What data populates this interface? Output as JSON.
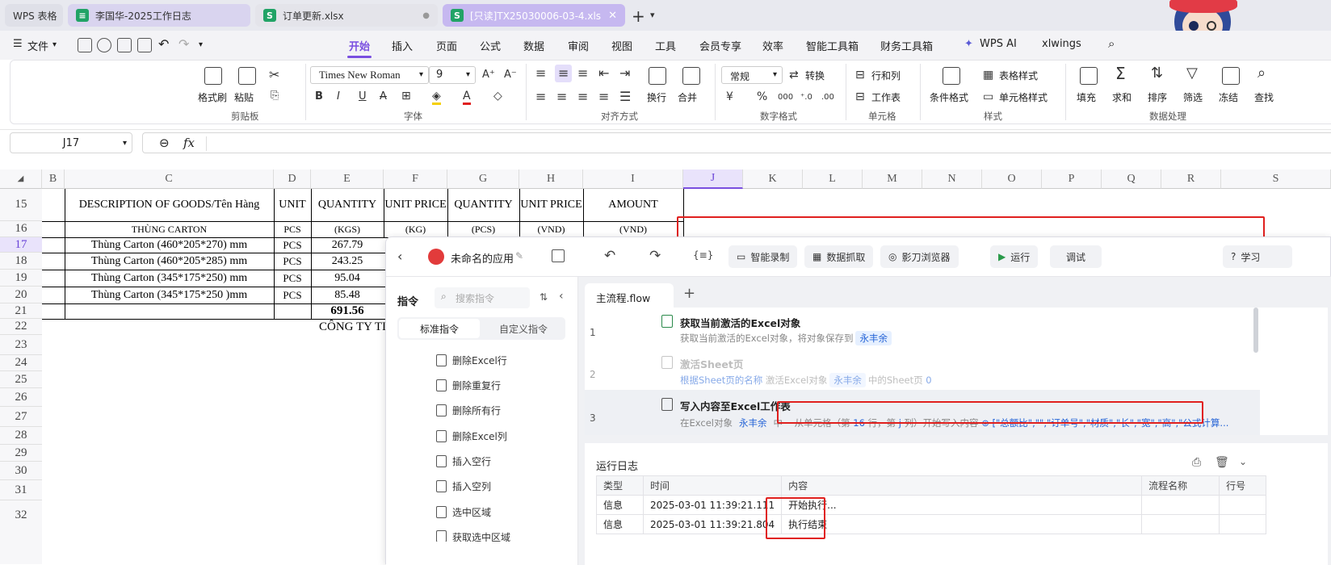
{
  "tabs": [
    {
      "label": "WPS 表格"
    },
    {
      "label": "李国华-2025工作日志",
      "icon": "≡"
    },
    {
      "label": "订单更新.xlsx",
      "icon": "S"
    },
    {
      "label": "[只读]TX25030006-03-4.xls",
      "icon": "S"
    }
  ],
  "menu": {
    "file": "文件",
    "items": [
      "开始",
      "插入",
      "页面",
      "公式",
      "数据",
      "审阅",
      "视图",
      "工具",
      "会员专享",
      "效率",
      "智能工具箱",
      "财务工具箱",
      "WPS AI",
      "xlwings"
    ],
    "active": "开始"
  },
  "ribbon": {
    "format_painter": "格式刷",
    "paste": "粘贴",
    "clipboard": "剪贴板",
    "font_name": "Times New Roman",
    "font_size": "9",
    "font_group": "字体",
    "wrap": "换行",
    "merge": "合并",
    "align_group": "对齐方式",
    "number_format": "常规",
    "convert": "转换",
    "number_group": "数字格式",
    "rows_cols": "行和列",
    "worksheet": "工作表",
    "cell_group": "单元格",
    "cond_format": "条件格式",
    "table_style": "表格样式",
    "cell_style": "单元格样式",
    "style_group": "样式",
    "fill": "填充",
    "sum": "求和",
    "sort": "排序",
    "filter": "筛选",
    "freeze": "冻结",
    "find": "查找",
    "data_group": "数据处理"
  },
  "formula_bar": {
    "name_box": "J17",
    "fx": "fx",
    "value": ""
  },
  "grid": {
    "columns": [
      "B",
      "C",
      "D",
      "E",
      "F",
      "G",
      "H",
      "I",
      "J",
      "K",
      "L",
      "M",
      "N",
      "O",
      "P",
      "Q",
      "R",
      "S"
    ],
    "rows": [
      "15",
      "16",
      "17",
      "18",
      "19",
      "20",
      "21",
      "22",
      "23",
      "24",
      "25",
      "26",
      "27",
      "28",
      "29",
      "30",
      "31",
      "32"
    ],
    "header15": [
      "DESCRIPTION OF GOODS/Tên Hàng",
      "UNIT",
      "QUANTITY",
      "UNIT PRICE",
      "QUANTITY",
      "UNIT PRICE",
      "AMOUNT"
    ],
    "header16": [
      "THÙNG CARTON",
      "PCS",
      "(KGS)",
      "(KG)",
      "(PCS)",
      "(VND)",
      "(VND)"
    ],
    "items": [
      {
        "desc": "Thùng Carton (460*205*270) mm",
        "unit": "PCS",
        "qty": "267.79"
      },
      {
        "desc": "Thùng Carton (460*205*285) mm",
        "unit": "PCS",
        "qty": "243.25"
      },
      {
        "desc": "Thùng Carton (345*175*250) mm",
        "unit": "PCS",
        "qty": "95.04"
      },
      {
        "desc": "Thùng Carton (345*175*250 )mm",
        "unit": "PCS",
        "qty": "85.48"
      }
    ],
    "total": "691.56",
    "company": "CÔNG TY TI"
  },
  "rpa": {
    "app_name": "未命名的应用",
    "toolbar": {
      "smart_record": "智能录制",
      "data_grab": "数据抓取",
      "browser": "影刀浏览器",
      "run": "运行",
      "debug": "调试",
      "learn": "学习"
    },
    "commands": {
      "title": "指令",
      "search_placeholder": "搜索指令",
      "tab_std": "标准指令",
      "tab_custom": "自定义指令",
      "items": [
        "删除Excel行",
        "删除重复行",
        "删除所有行",
        "删除Excel列",
        "插入空行",
        "插入空列",
        "选中区域",
        "获取选中区域"
      ]
    },
    "flow_tab": "主流程.flow",
    "steps": [
      {
        "num": "1",
        "title": "获取当前激活的Excel对象",
        "desc": "获取当前激活的Excel对象，将对象保存到",
        "var": "永丰余"
      },
      {
        "num": "2",
        "title": "激活Sheet页",
        "desc": "根据Sheet页的名称",
        "desc2": "激活Excel对象",
        "var": "永丰余",
        "desc3": "中的Sheet页",
        "page": "0"
      },
      {
        "num": "3",
        "title": "写入内容至Excel工作表",
        "desc": "在Excel对象",
        "var": "永丰余",
        "desc2": "中",
        "desc3": "从单元格（第",
        "row": "16",
        "desc4": "行，第",
        "col": "j",
        "desc5": "列）开始写入内容",
        "content": "[\"总额比\",\"\",\"订单号\",\"材质\",\"长\",\"宽\",\"高\",\"公式计算..."
      }
    ],
    "log": {
      "title": "运行日志",
      "headers": [
        "类型",
        "时间",
        "内容",
        "流程名称",
        "行号"
      ],
      "rows": [
        {
          "type": "信息",
          "time": "2025-03-01 11:39:21.111",
          "content": "开始执行..."
        },
        {
          "type": "信息",
          "time": "2025-03-01 11:39:21.804",
          "content": "执行结束"
        }
      ]
    }
  }
}
